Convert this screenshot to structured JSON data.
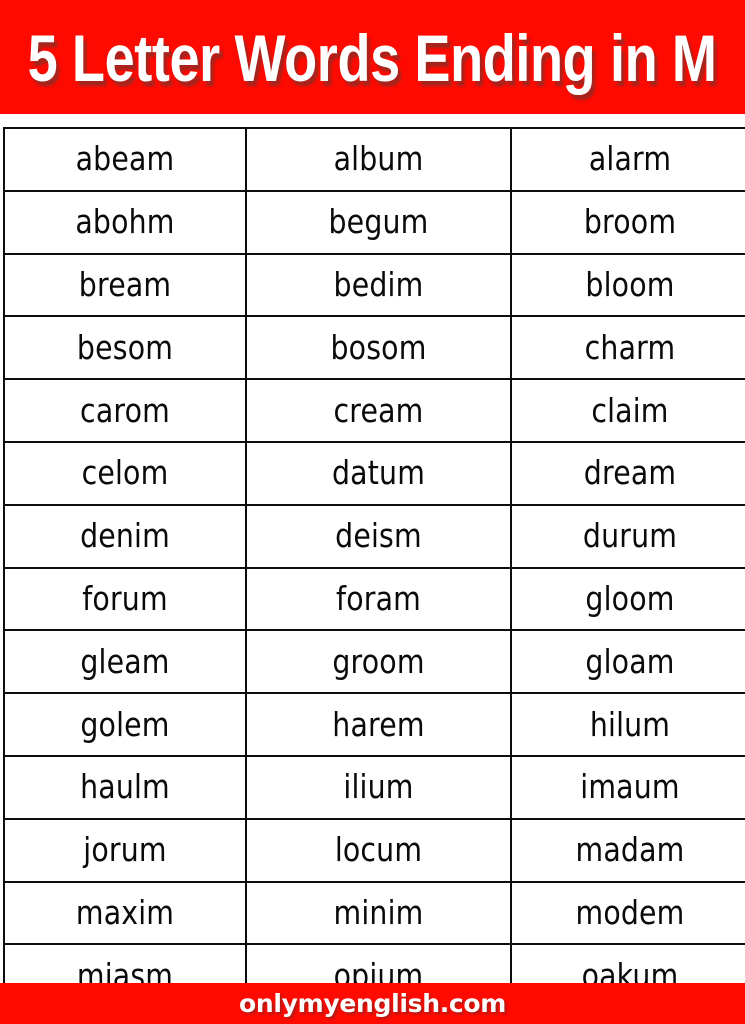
{
  "header": {
    "title": "5 Letter Words Ending in M",
    "background_color": "#ff0a00",
    "text_color": "#ffffff"
  },
  "footer": {
    "site": "onlymyenglish.com",
    "background_color": "#ff0a00",
    "text_color": "#ffffff"
  },
  "table": {
    "border_color": "#0d0d0d",
    "columns": 3,
    "rows": 14,
    "cells": [
      [
        "abeam",
        "album",
        "alarm"
      ],
      [
        "abohm",
        "begum",
        "broom"
      ],
      [
        "bream",
        "bedim",
        "bloom"
      ],
      [
        "besom",
        "bosom",
        "charm"
      ],
      [
        "carom",
        "cream",
        "claim"
      ],
      [
        "celom",
        "datum",
        "dream"
      ],
      [
        "denim",
        "deism",
        "durum"
      ],
      [
        "forum",
        "foram",
        "gloom"
      ],
      [
        "gleam",
        "groom",
        "gloam"
      ],
      [
        "golem",
        "harem",
        "hilum"
      ],
      [
        "haulm",
        "ilium",
        "imaum"
      ],
      [
        "jorum",
        "locum",
        "madam"
      ],
      [
        "maxim",
        "minim",
        "modem"
      ],
      [
        "miasm",
        "opium",
        "oakum"
      ]
    ]
  }
}
